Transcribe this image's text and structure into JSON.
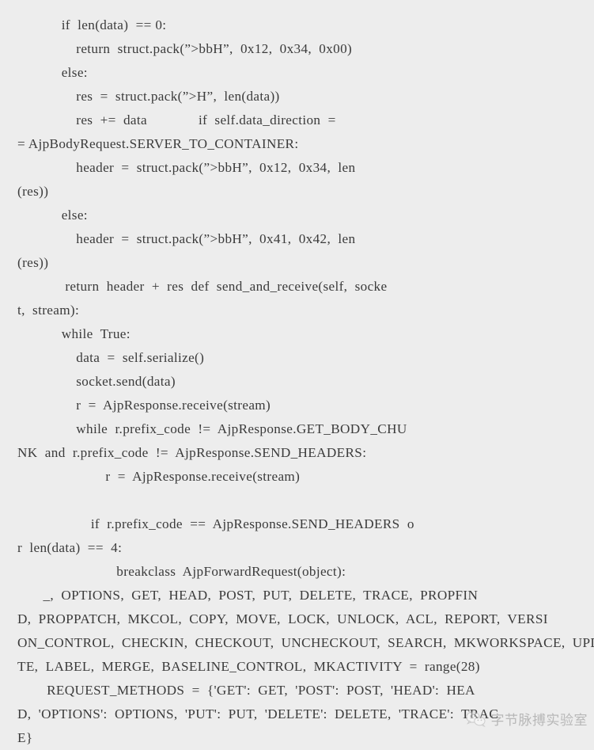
{
  "page": {
    "background_color": "#ededed",
    "text_color": "#3b3b3b",
    "kind": "code-screenshot-article"
  },
  "code": {
    "language": "python",
    "lines": [
      "            if  len(data)  == 0:",
      "                return  struct.pack(”>bbH”,  0x12,  0x34,  0x00)",
      "            else:",
      "                res  =  struct.pack(”>H”,  len(data))",
      "                res  +=  data              if  self.data_direction  =",
      "= AjpBodyRequest.SERVER_TO_CONTAINER:",
      "                header  =  struct.pack(”>bbH”,  0x12,  0x34,  len",
      "(res))",
      "            else:",
      "                header  =  struct.pack(”>bbH”,  0x41,  0x42,  len",
      "(res))",
      "             return  header  +  res  def  send_and_receive(self,  socke",
      "t,  stream):",
      "            while  True:",
      "                data  =  self.serialize()",
      "                socket.send(data)",
      "                r  =  AjpResponse.receive(stream)",
      "                while  r.prefix_code  !=  AjpResponse.GET_BODY_CHU",
      "NK  and  r.prefix_code  !=  AjpResponse.SEND_HEADERS:",
      "                        r  =  AjpResponse.receive(stream)",
      "",
      "                    if  r.prefix_code  ==  AjpResponse.SEND_HEADERS  o",
      "r  len(data)  ==  4:",
      "                           breakclass  AjpForwardRequest(object):",
      "       _,  OPTIONS,  GET,  HEAD,  POST,  PUT,  DELETE,  TRACE,  PROPFIN",
      "D,  PROPPATCH,  MKCOL,  COPY,  MOVE,  LOCK,  UNLOCK,  ACL,  REPORT,  VERSI",
      "ON_CONTROL,  CHECKIN,  CHECKOUT,  UNCHECKOUT,  SEARCH,  MKWORKSPACE,  UPDA",
      "TE,  LABEL,  MERGE,  BASELINE_CONTROL,  MKACTIVITY  =  range(28)",
      "        REQUEST_METHODS  =  {'GET':  GET,  'POST':  POST,  'HEAD':  HEA",
      "D,  'OPTIONS':  OPTIONS,  'PUT':  PUT,  'DELETE':  DELETE,  'TRACE':  TRAC",
      "E}"
    ]
  },
  "watermark": {
    "icon": "wechat-icon",
    "text": "字节脉搏实验室",
    "color": "#6e6e6e"
  }
}
